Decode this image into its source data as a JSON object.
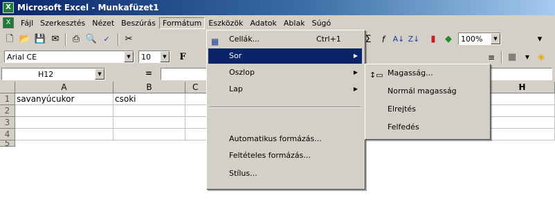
{
  "window": {
    "title": "Microsoft Excel - Munkafüzet1"
  },
  "menubar": [
    "Fájl",
    "Szerkesztés",
    "Nézet",
    "Beszúrás",
    "Formátum",
    "Eszközök",
    "Adatok",
    "Ablak",
    "Súgó"
  ],
  "toolbar": {
    "zoom": "100%"
  },
  "formatting": {
    "font": "Arial CE",
    "size": "10",
    "bold": "F"
  },
  "formula_bar": {
    "name_box": "H12",
    "equals": "="
  },
  "columns": [
    "A",
    "B",
    "C",
    "H"
  ],
  "rows": [
    "1",
    "2",
    "3",
    "4",
    "5"
  ],
  "cells": {
    "A1": "savanyúcukor",
    "B1": "csoki"
  },
  "format_menu": {
    "cells": {
      "label": "Cellák...",
      "shortcut": "Ctrl+1"
    },
    "row": "Sor",
    "column": "Oszlop",
    "sheet": "Lap",
    "autoformat": "Automatikus formázás...",
    "conditional": "Feltételes formázás...",
    "style": "Stílus..."
  },
  "row_submenu": {
    "height": "Magasság...",
    "autofit": "Normál magasság",
    "hide": "Elrejtés",
    "unhide": "Felfedés"
  },
  "colors": {
    "highlight": "#0a246a",
    "menu_bg": "#d4d0c8"
  }
}
